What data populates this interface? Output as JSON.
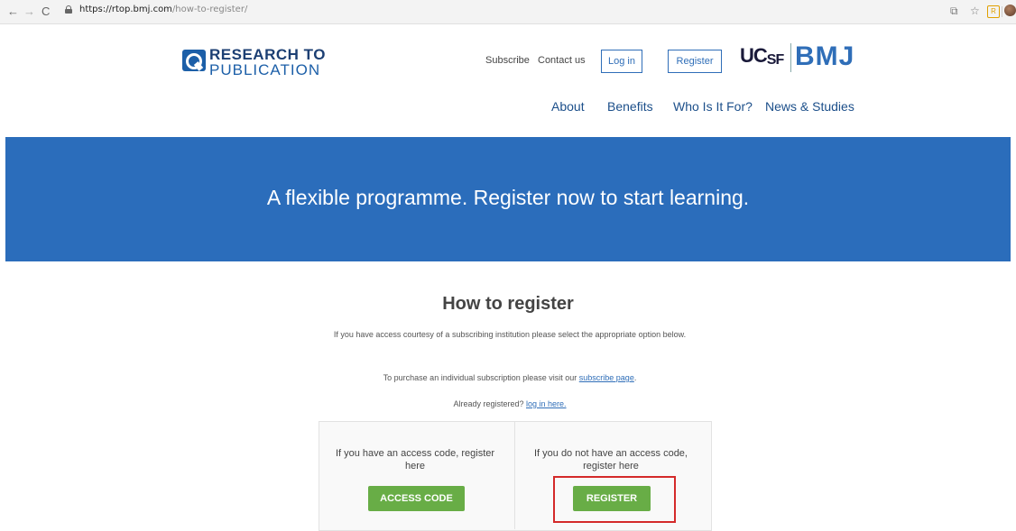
{
  "browser": {
    "url_host": "https://rtop.bmj.com",
    "url_path": "/how-to-register/",
    "back_glyph": "←",
    "forward_glyph": "→",
    "reload_glyph": "C",
    "star_glyph": "☆",
    "translate_glyph": "⧉",
    "ext_glyph": "R"
  },
  "header": {
    "logo_line1": "RESEARCH TO",
    "logo_line2": "PUBLICATION",
    "subscribe": "Subscribe",
    "contact": "Contact us",
    "login": "Log in",
    "register": "Register",
    "ucsf_uc": "UC",
    "ucsf_sf": "SF",
    "bmj": "BMJ"
  },
  "nav": {
    "items": [
      "About",
      "Benefits",
      "Who Is It For?",
      "News & Studies"
    ]
  },
  "hero": {
    "text": "A flexible programme. Register now to start learning."
  },
  "main": {
    "heading": "How to register",
    "intro": "If you have access courtesy of a subscribing institution please select the appropriate option below.",
    "purchase_text": "To purchase an individual subscription please visit our ",
    "purchase_link": "subscribe page",
    "purchase_end": ".",
    "already_text": "Already registered? ",
    "already_link": "log in here.",
    "option_left_text": "If you have an access code, register here",
    "option_left_button": "ACCESS CODE",
    "option_right_text": "If you do not have an access code, register here",
    "option_right_button": "REGISTER"
  },
  "colors": {
    "hero_blue": "#2b6dbb",
    "button_green": "#68ad46",
    "highlight_red": "#d42a2a",
    "link_blue": "#2f6eb8"
  }
}
